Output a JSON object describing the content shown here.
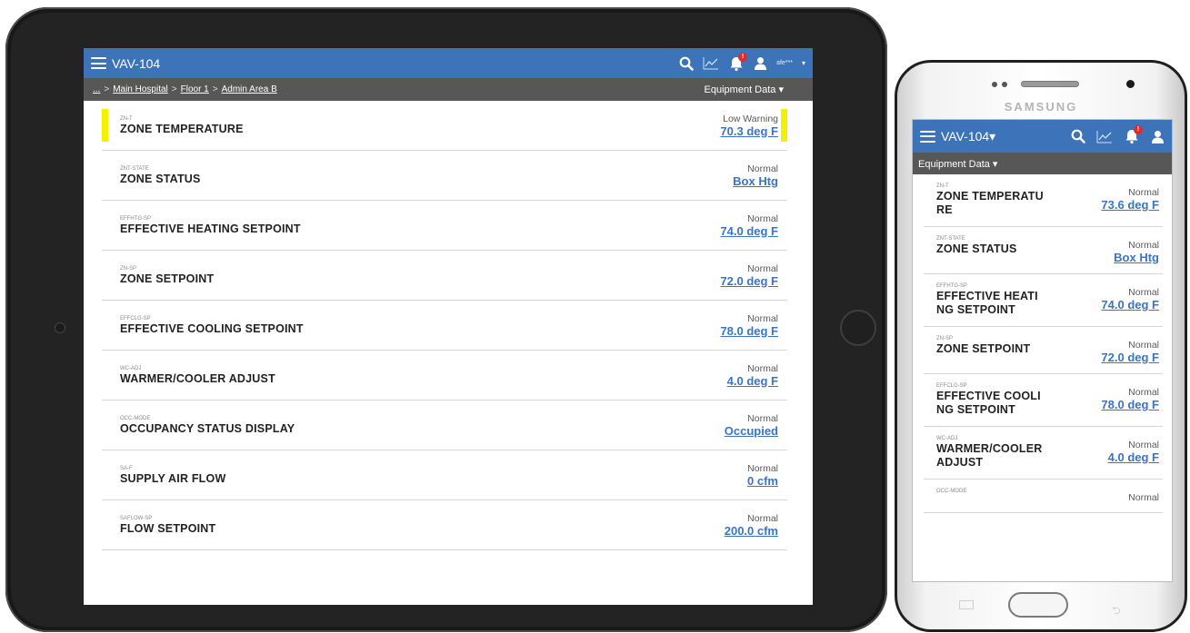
{
  "tablet": {
    "app_title": "VAV-104",
    "user_name": "afe***",
    "bell_badge": "!",
    "breadcrumb": {
      "ellipsis": "...",
      "items": [
        "Main Hospital",
        "Floor 1",
        "Admin Area B"
      ],
      "separator": ">"
    },
    "equipment_menu": "Equipment Data ▾",
    "points": [
      {
        "code": "ZN-T",
        "name": "ZONE TEMPERATURE",
        "status": "Low Warning",
        "value": "70.3 deg F",
        "warning": true
      },
      {
        "code": "ZNT-STATE",
        "name": "ZONE STATUS",
        "status": "Normal",
        "value": "Box Htg",
        "warning": false
      },
      {
        "code": "EFFHTG-SP",
        "name": "EFFECTIVE HEATING SETPOINT",
        "status": "Normal",
        "value": "74.0 deg F",
        "warning": false
      },
      {
        "code": "ZN-SP",
        "name": "ZONE SETPOINT",
        "status": "Normal",
        "value": "72.0 deg F",
        "warning": false
      },
      {
        "code": "EFFCLG-SP",
        "name": "EFFECTIVE COOLING SETPOINT",
        "status": "Normal",
        "value": "78.0 deg F",
        "warning": false
      },
      {
        "code": "WC-ADJ",
        "name": "WARMER/COOLER ADJUST",
        "status": "Normal",
        "value": "4.0 deg F",
        "warning": false
      },
      {
        "code": "OCC-MODE",
        "name": "OCCUPANCY STATUS DISPLAY",
        "status": "Normal",
        "value": "Occupied",
        "warning": false
      },
      {
        "code": "SA-F",
        "name": "SUPPLY AIR FLOW",
        "status": "Normal",
        "value": "0 cfm",
        "warning": false
      },
      {
        "code": "SAFLOW-SP",
        "name": "FLOW SETPOINT",
        "status": "Normal",
        "value": "200.0 cfm",
        "warning": false
      }
    ]
  },
  "phone": {
    "brand": "SAMSUNG",
    "app_title": "VAV-104▾",
    "bell_badge": "!",
    "equipment_menu": "Equipment Data ▾",
    "points": [
      {
        "code": "ZN-T",
        "name": "ZONE TEMPERATURE",
        "status": "Normal",
        "value": "73.6 deg F"
      },
      {
        "code": "ZNT-STATE",
        "name": "ZONE STATUS",
        "status": "Normal",
        "value": "Box Htg"
      },
      {
        "code": "EFFHTG-SP",
        "name": "EFFECTIVE HEATING SETPOINT",
        "status": "Normal",
        "value": "74.0 deg F"
      },
      {
        "code": "ZN-SP",
        "name": "ZONE SETPOINT",
        "status": "Normal",
        "value": "72.0 deg F"
      },
      {
        "code": "EFFCLG-SP",
        "name": "EFFECTIVE COOLING SETPOINT",
        "status": "Normal",
        "value": "78.0 deg F"
      },
      {
        "code": "WC-ADJ",
        "name": "WARMER/COOLER ADJUST",
        "status": "Normal",
        "value": "4.0 deg F"
      },
      {
        "code": "OCC-MODE",
        "name": "",
        "status": "Normal",
        "value": ""
      }
    ]
  },
  "colors": {
    "header_blue": "#3d73b9",
    "breadcrumb_gray": "#575757",
    "link_blue": "#3a74c4",
    "warning_yellow": "#f5f000",
    "badge_red": "#e02b2b"
  },
  "icons": {
    "menu": "hamburger-icon",
    "search": "search-icon",
    "trend": "trend-chart-icon",
    "alarm": "bell-icon",
    "user": "user-icon"
  }
}
